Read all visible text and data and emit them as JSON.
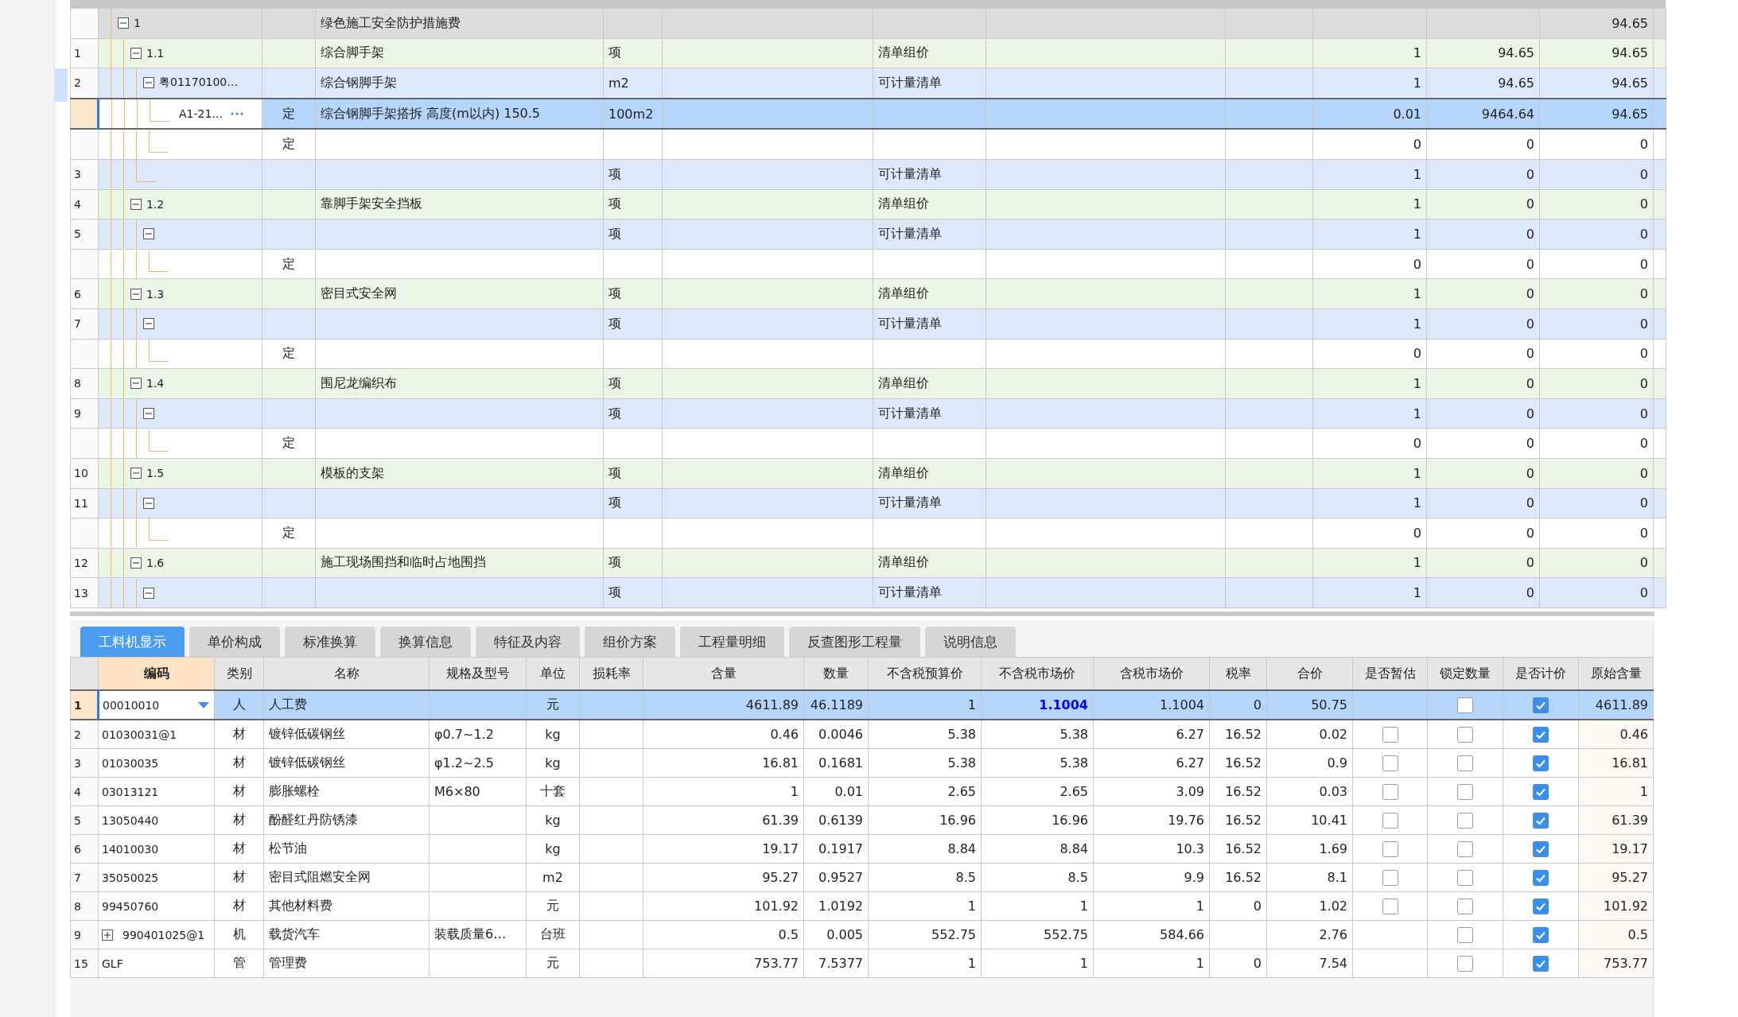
{
  "bill_tree": {
    "rows": [
      {
        "kind": "section",
        "code": "1",
        "name": "绿色施工安全防护措施费",
        "total": "94.65",
        "expanded": true,
        "selected": false,
        "children": [
          {
            "kind": "group",
            "num": "1",
            "code": "1.1",
            "name": "综合脚手架",
            "unit": "项",
            "category": "清单组价",
            "qty": "1",
            "price": "94.65",
            "total": "94.65",
            "expanded": true,
            "selected": false,
            "children": [
              {
                "kind": "measure",
                "num": "2",
                "code": "粤01170100…",
                "name": "综合钢脚手架",
                "unit": "m2",
                "category": "可计量清单",
                "qty": "1",
                "price": "94.65",
                "total": "94.65",
                "expanded": true,
                "selected": false,
                "children": [
                  {
                    "kind": "quota",
                    "code": "A1-21…",
                    "type": "定",
                    "name": "综合钢脚手架搭拆 高度(m以内) 150.5",
                    "unit": "100m2",
                    "qty": "0.01",
                    "price": "9464.64",
                    "total": "94.65",
                    "selected": true
                  },
                  {
                    "kind": "quota",
                    "type": "定",
                    "qty": "0",
                    "price": "0",
                    "total": "0",
                    "selected": false
                  }
                ]
              },
              {
                "kind": "measure",
                "num": "3",
                "unit": "项",
                "category": "可计量清单",
                "qty": "1",
                "price": "0",
                "total": "0",
                "selected": false
              }
            ]
          },
          {
            "kind": "group",
            "num": "4",
            "code": "1.2",
            "name": "靠脚手架安全挡板",
            "unit": "项",
            "category": "清单组价",
            "qty": "1",
            "price": "0",
            "total": "0",
            "expanded": true,
            "selected": false,
            "children": [
              {
                "kind": "measure",
                "num": "5",
                "unit": "项",
                "category": "可计量清单",
                "qty": "1",
                "price": "0",
                "total": "0",
                "expanded": true,
                "selected": false,
                "children": [
                  {
                    "kind": "quota",
                    "type": "定",
                    "qty": "0",
                    "price": "0",
                    "total": "0",
                    "selected": false
                  }
                ]
              }
            ]
          },
          {
            "kind": "group",
            "num": "6",
            "code": "1.3",
            "name": "密目式安全网",
            "unit": "项",
            "category": "清单组价",
            "qty": "1",
            "price": "0",
            "total": "0",
            "expanded": true,
            "selected": false,
            "children": [
              {
                "kind": "measure",
                "num": "7",
                "unit": "项",
                "category": "可计量清单",
                "qty": "1",
                "price": "0",
                "total": "0",
                "expanded": true,
                "selected": false,
                "children": [
                  {
                    "kind": "quota",
                    "type": "定",
                    "qty": "0",
                    "price": "0",
                    "total": "0",
                    "selected": false
                  }
                ]
              }
            ]
          },
          {
            "kind": "group",
            "num": "8",
            "code": "1.4",
            "name": "围尼龙编织布",
            "unit": "项",
            "category": "清单组价",
            "qty": "1",
            "price": "0",
            "total": "0",
            "expanded": true,
            "selected": false,
            "children": [
              {
                "kind": "measure",
                "num": "9",
                "unit": "项",
                "category": "可计量清单",
                "qty": "1",
                "price": "0",
                "total": "0",
                "expanded": true,
                "selected": false,
                "children": [
                  {
                    "kind": "quota",
                    "type": "定",
                    "qty": "0",
                    "price": "0",
                    "total": "0",
                    "selected": false
                  }
                ]
              }
            ]
          },
          {
            "kind": "group",
            "num": "10",
            "code": "1.5",
            "name": "模板的支架",
            "unit": "项",
            "category": "清单组价",
            "qty": "1",
            "price": "0",
            "total": "0",
            "expanded": true,
            "selected": false,
            "children": [
              {
                "kind": "measure",
                "num": "11",
                "unit": "项",
                "category": "可计量清单",
                "qty": "1",
                "price": "0",
                "total": "0",
                "expanded": true,
                "selected": false,
                "children": [
                  {
                    "kind": "quota",
                    "type": "定",
                    "qty": "0",
                    "price": "0",
                    "total": "0",
                    "selected": false
                  }
                ]
              }
            ]
          },
          {
            "kind": "group",
            "num": "12",
            "code": "1.6",
            "name": "施工现场围挡和临时占地围挡",
            "unit": "项",
            "category": "清单组价",
            "qty": "1",
            "price": "0",
            "total": "0",
            "expanded": true,
            "selected": false,
            "children": [
              {
                "kind": "measure",
                "num": "13",
                "unit": "项",
                "category": "可计量清单",
                "qty": "1",
                "price": "0",
                "total": "0",
                "expanded": true,
                "selected": false
              }
            ]
          }
        ]
      }
    ]
  },
  "tabs": [
    {
      "label": "工料机显示",
      "selected": true
    },
    {
      "label": "单价构成",
      "selected": false
    },
    {
      "label": "标准换算",
      "selected": false
    },
    {
      "label": "换算信息",
      "selected": false
    },
    {
      "label": "特征及内容",
      "selected": false
    },
    {
      "label": "组价方案",
      "selected": false
    },
    {
      "label": "工程量明细",
      "selected": false
    },
    {
      "label": "反查图形工程量",
      "selected": false
    },
    {
      "label": "说明信息",
      "selected": false
    }
  ],
  "resources": {
    "columns": [
      {
        "label": "编码",
        "selected": true
      },
      {
        "label": "类别",
        "selected": false
      },
      {
        "label": "名称",
        "selected": false
      },
      {
        "label": "规格及型号",
        "selected": false
      },
      {
        "label": "单位",
        "selected": false
      },
      {
        "label": "损耗率",
        "selected": false
      },
      {
        "label": "含量",
        "selected": false
      },
      {
        "label": "数量",
        "selected": false
      },
      {
        "label": "不含税预算价",
        "selected": false
      },
      {
        "label": "不含税市场价",
        "selected": false
      },
      {
        "label": "含税市场价",
        "selected": false
      },
      {
        "label": "税率",
        "selected": false
      },
      {
        "label": "合价",
        "selected": false
      },
      {
        "label": "是否暂估",
        "selected": false
      },
      {
        "label": "锁定数量",
        "selected": false
      },
      {
        "label": "是否计价",
        "selected": false
      },
      {
        "label": "原始含量",
        "selected": false
      }
    ],
    "rows": [
      {
        "num": "1",
        "code": "00010010",
        "type": "人",
        "name": "人工费",
        "unit": "元",
        "content": "4611.89",
        "qty": "46.1189",
        "budget": "1",
        "market": "1.1004",
        "market_modified": true,
        "tax_market": "1.1004",
        "tax_rate": "0",
        "total": "50.75",
        "lock": false,
        "priced": true,
        "original": "4611.89",
        "selected": true
      },
      {
        "num": "2",
        "code": "01030031@1",
        "type": "材",
        "name": "镀锌低碳钢丝",
        "spec": "φ0.7~1.2",
        "unit": "kg",
        "content": "0.46",
        "qty": "0.0046",
        "budget": "5.38",
        "market": "5.38",
        "market_modified": false,
        "tax_market": "6.27",
        "tax_rate": "16.52",
        "total": "0.02",
        "estimate": false,
        "lock": false,
        "priced": true,
        "original": "0.46",
        "selected": false
      },
      {
        "num": "3",
        "code": "01030035",
        "type": "材",
        "name": "镀锌低碳钢丝",
        "spec": "φ1.2~2.5",
        "unit": "kg",
        "content": "16.81",
        "qty": "0.1681",
        "budget": "5.38",
        "market": "5.38",
        "market_modified": false,
        "tax_market": "6.27",
        "tax_rate": "16.52",
        "total": "0.9",
        "estimate": false,
        "lock": false,
        "priced": true,
        "original": "16.81",
        "selected": false
      },
      {
        "num": "4",
        "code": "03013121",
        "type": "材",
        "name": "膨胀螺栓",
        "spec": "M6×80",
        "unit": "十套",
        "content": "1",
        "qty": "0.01",
        "budget": "2.65",
        "market": "2.65",
        "market_modified": false,
        "tax_market": "3.09",
        "tax_rate": "16.52",
        "total": "0.03",
        "estimate": false,
        "lock": false,
        "priced": true,
        "original": "1",
        "selected": false
      },
      {
        "num": "5",
        "code": "13050440",
        "type": "材",
        "name": "酚醛红丹防锈漆",
        "unit": "kg",
        "content": "61.39",
        "qty": "0.6139",
        "budget": "16.96",
        "market": "16.96",
        "market_modified": false,
        "tax_market": "19.76",
        "tax_rate": "16.52",
        "total": "10.41",
        "estimate": false,
        "lock": false,
        "priced": true,
        "original": "61.39",
        "selected": false
      },
      {
        "num": "6",
        "code": "14010030",
        "type": "材",
        "name": "松节油",
        "unit": "kg",
        "content": "19.17",
        "qty": "0.1917",
        "budget": "8.84",
        "market": "8.84",
        "market_modified": false,
        "tax_market": "10.3",
        "tax_rate": "16.52",
        "total": "1.69",
        "estimate": false,
        "lock": false,
        "priced": true,
        "original": "19.17",
        "selected": false
      },
      {
        "num": "7",
        "code": "35050025",
        "type": "材",
        "name": "密目式阻燃安全网",
        "unit": "m2",
        "content": "95.27",
        "qty": "0.9527",
        "budget": "8.5",
        "market": "8.5",
        "market_modified": false,
        "tax_market": "9.9",
        "tax_rate": "16.52",
        "total": "8.1",
        "estimate": false,
        "lock": false,
        "priced": true,
        "original": "95.27",
        "selected": false
      },
      {
        "num": "8",
        "code": "99450760",
        "type": "材",
        "name": "其他材料费",
        "unit": "元",
        "content": "101.92",
        "qty": "1.0192",
        "budget": "1",
        "market": "1",
        "market_modified": false,
        "tax_market": "1",
        "tax_rate": "0",
        "total": "1.02",
        "estimate": false,
        "lock": false,
        "priced": true,
        "original": "101.92",
        "selected": false
      },
      {
        "num": "9",
        "code": "990401025@1",
        "expanded": false,
        "type": "机",
        "name": "载货汽车",
        "spec": "装载质量6…",
        "unit": "台班",
        "content": "0.5",
        "qty": "0.005",
        "budget": "552.75",
        "market": "552.75",
        "market_modified": false,
        "tax_market": "584.66",
        "total": "2.76",
        "lock": false,
        "priced": true,
        "original": "0.5",
        "selected": false
      },
      {
        "num": "15",
        "code": "GLF",
        "type": "管",
        "name": "管理费",
        "unit": "元",
        "content": "753.77",
        "qty": "7.5377",
        "budget": "1",
        "market": "1",
        "market_modified": false,
        "tax_market": "1",
        "tax_rate": "0",
        "total": "7.54",
        "lock": false,
        "priced": true,
        "original": "753.77",
        "selected": false
      }
    ]
  }
}
